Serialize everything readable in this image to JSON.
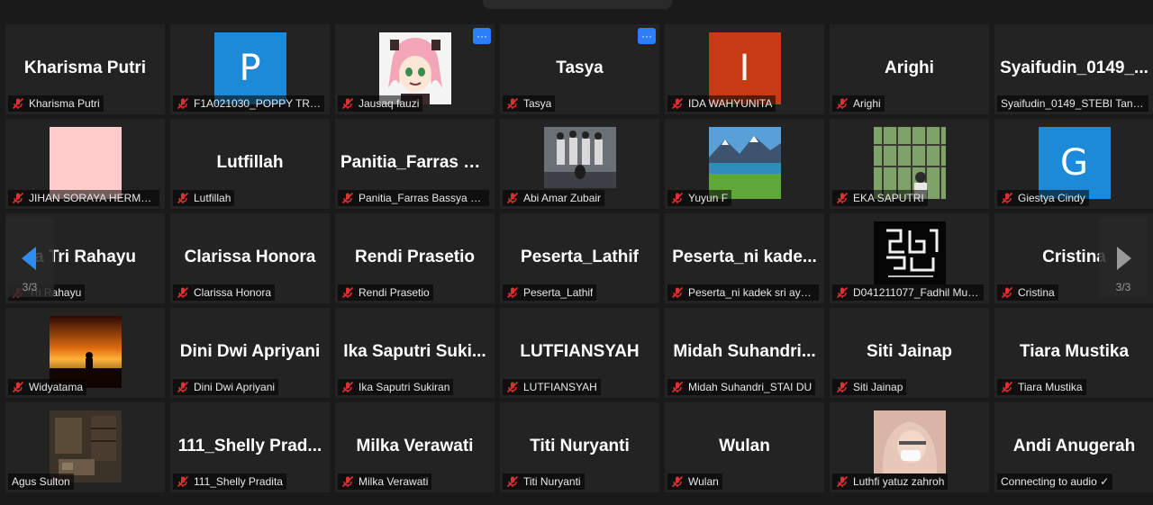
{
  "participants": [
    {
      "big": "Kharisma Putri",
      "label": "Kharisma Putri",
      "muted": true
    },
    {
      "avatar": "letter",
      "letter": "P",
      "color": "#1c8ad6",
      "label": "F1A021030_POPPY TRI W...",
      "muted": true
    },
    {
      "avatar": "anime",
      "label": "Jausaq fauzi",
      "muted": true,
      "menu": "···"
    },
    {
      "big": "Tasya",
      "label": "Tasya",
      "muted": true,
      "menu": "···"
    },
    {
      "avatar": "letter",
      "letter": "I",
      "color": "#c83a12",
      "label": "IDA WAHYUNITA",
      "muted": true
    },
    {
      "big": "Arighi",
      "label": "Arighi",
      "muted": true
    },
    {
      "big": "Syaifudin_0149_...",
      "label": "Syaifudin_0149_STEBI Tangg...",
      "muted": false
    },
    {
      "avatar": "pink",
      "label": "JIHAN SORAYA HERMAW...",
      "muted": true
    },
    {
      "big": "Lutfillah",
      "label": "Lutfillah",
      "muted": true
    },
    {
      "big": "Panitia_Farras  B...",
      "label": "Panitia_Farras Bassya Pri...",
      "muted": true
    },
    {
      "avatar": "band",
      "label": "Abi Amar Zubair",
      "muted": true
    },
    {
      "avatar": "lake",
      "label": "Yuyun F",
      "muted": true
    },
    {
      "avatar": "greenhouse",
      "label": "EKA SAPUTRI",
      "muted": true
    },
    {
      "avatar": "letter",
      "letter": "G",
      "color": "#1c8ad6",
      "label": "Giestya Cindy",
      "muted": true
    },
    {
      "big": "a Tri Rahayu",
      "label": "Tri Rahayu",
      "muted": true
    },
    {
      "big": "Clarissa Honora",
      "label": "Clarissa Honora",
      "muted": true
    },
    {
      "big": "Rendi Prasetio",
      "label": "Rendi Prasetio",
      "muted": true
    },
    {
      "big": "Peserta_Lathif",
      "label": "Peserta_Lathif",
      "muted": true
    },
    {
      "big": "Peserta_ni  kade...",
      "label": "Peserta_ni kadek sri ayu a...",
      "muted": true
    },
    {
      "avatar": "calligraphy",
      "label": "D041211077_Fadhil Mufli...",
      "muted": true
    },
    {
      "big": "Cristina",
      "label": "Cristina",
      "muted": true
    },
    {
      "avatar": "sunset",
      "label": "Widyatama",
      "muted": true
    },
    {
      "big": "Dini Dwi Apriyani",
      "label": "Dini Dwi Apriyani",
      "muted": true
    },
    {
      "big": "Ika Saputri  Suki...",
      "label": "Ika Saputri Sukiran",
      "muted": true
    },
    {
      "big": "LUTFIANSYAH",
      "label": "LUTFIANSYAH",
      "muted": true
    },
    {
      "big": "Midah  Suhandri...",
      "label": "Midah Suhandri_STAI DU",
      "muted": true
    },
    {
      "big": "Siti Jainap",
      "label": "Siti Jainap",
      "muted": true
    },
    {
      "big": "Tiara Mustika",
      "label": "Tiara Mustika",
      "muted": true
    },
    {
      "avatar": "room",
      "label": "Agus Sulton",
      "muted": false
    },
    {
      "big": "111_Shelly  Prad...",
      "label": "111_Shelly Pradita",
      "muted": true
    },
    {
      "big": "Milka Verawati",
      "label": "Milka Verawati",
      "muted": true
    },
    {
      "big": "Titi Nuryanti",
      "label": "Titi Nuryanti",
      "muted": true
    },
    {
      "big": "Wulan",
      "label": "Wulan",
      "muted": true
    },
    {
      "avatar": "hijab",
      "label": "Luthfi yatuz zahroh",
      "muted": true
    },
    {
      "big": "Andi Anugerah",
      "label": "Connecting to audio ✓",
      "muted": false
    }
  ],
  "pager": {
    "left_count": "3/3",
    "right_count": "3/3",
    "left_icon": "arrow-left-icon",
    "right_icon": "arrow-right-icon",
    "left_color": "#2d8cf0",
    "right_color": "#9a9a9a"
  },
  "mic_icon": "muted-mic-icon",
  "mic_color": "#e03131"
}
